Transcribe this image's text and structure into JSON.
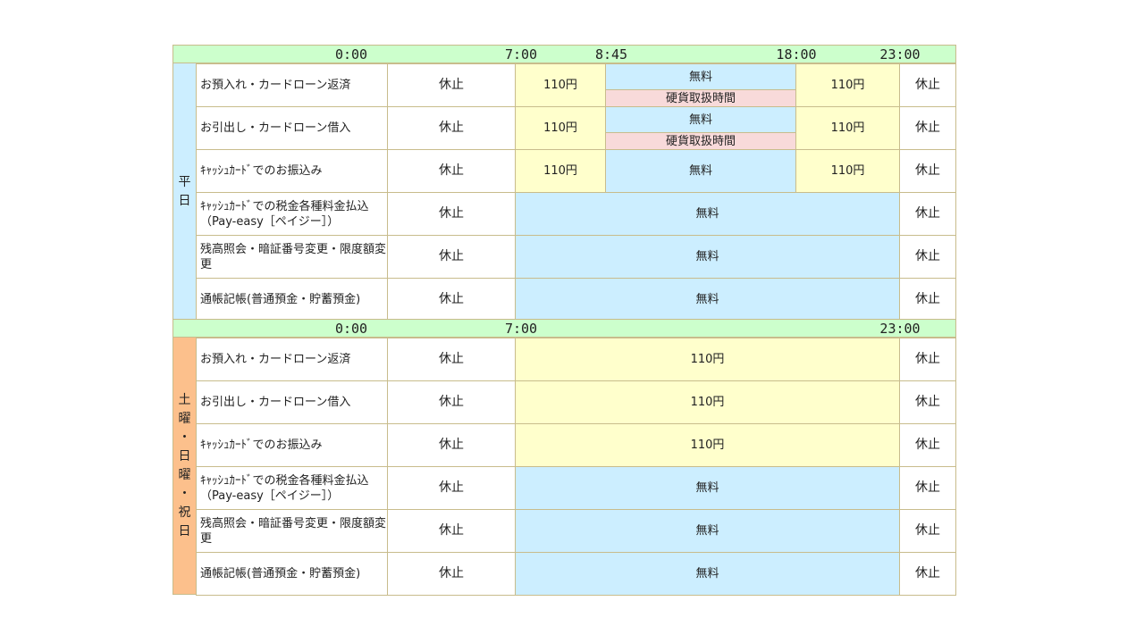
{
  "weekday": {
    "times": [
      "0:00",
      "7:00",
      "8:45",
      "18:00",
      "23:00"
    ],
    "label": [
      "平",
      "日"
    ],
    "rows": [
      {
        "label": "お預入れ・カードローン返済",
        "closed": "休止",
        "fee_early": "110円",
        "free": "無料",
        "coin": "硬貨取扱時間",
        "fee_late": "110円",
        "closed_late": "休止"
      },
      {
        "label": "お引出し・カードローン借入",
        "closed": "休止",
        "fee_early": "110円",
        "free": "無料",
        "coin": "硬貨取扱時間",
        "fee_late": "110円",
        "closed_late": "休止"
      },
      {
        "label": "ｷｬｯｼｭｶｰﾄﾞでのお振込み",
        "closed": "休止",
        "fee_early": "110円",
        "free": "無料",
        "fee_late": "110円",
        "closed_late": "休止"
      },
      {
        "label": "ｷｬｯｼｭｶｰﾄﾞでの税金各種料金払込（Pay-easy［ペイジー］）",
        "closed": "休止",
        "all": "無料",
        "closed_late": "休止"
      },
      {
        "label": "残高照会・暗証番号変更・限度額変更",
        "closed": "休止",
        "all": "無料",
        "closed_late": "休止"
      },
      {
        "label": "通帳記帳(普通預金・貯蓄預金)",
        "closed": "休止",
        "all": "無料",
        "closed_late": "休止"
      }
    ]
  },
  "holiday": {
    "times": [
      "0:00",
      "7:00",
      "23:00"
    ],
    "label": [
      "土",
      "曜",
      "・",
      "日",
      "曜",
      "・",
      "祝",
      "日"
    ],
    "rows": [
      {
        "label": "お預入れ・カードローン返済",
        "closed": "休止",
        "all": "110円",
        "closed_late": "休止"
      },
      {
        "label": "お引出し・カードローン借入",
        "closed": "休止",
        "all": "110円",
        "closed_late": "休止"
      },
      {
        "label": "ｷｬｯｼｭｶｰﾄﾞでのお振込み",
        "closed": "休止",
        "all": "110円",
        "closed_late": "休止"
      },
      {
        "label": "ｷｬｯｼｭｶｰﾄﾞでの税金各種料金払込（Pay-easy［ペイジー］）",
        "closed": "休止",
        "all": "無料",
        "closed_late": "休止"
      },
      {
        "label": "残高照会・暗証番号変更・限度額変更",
        "closed": "休止",
        "all": "無料",
        "closed_late": "休止"
      },
      {
        "label": "通帳記帳(普通預金・貯蓄預金)",
        "closed": "休止",
        "all": "無料",
        "closed_late": "休止"
      }
    ]
  },
  "colors": {
    "time_bar": "#ccffcc",
    "fee": "#ffffcc",
    "free": "#cceeff",
    "coin": "#f8dada",
    "weekday_side": "#cceeff",
    "holiday_side": "#fcc08c",
    "border": "#c8bc8c"
  }
}
